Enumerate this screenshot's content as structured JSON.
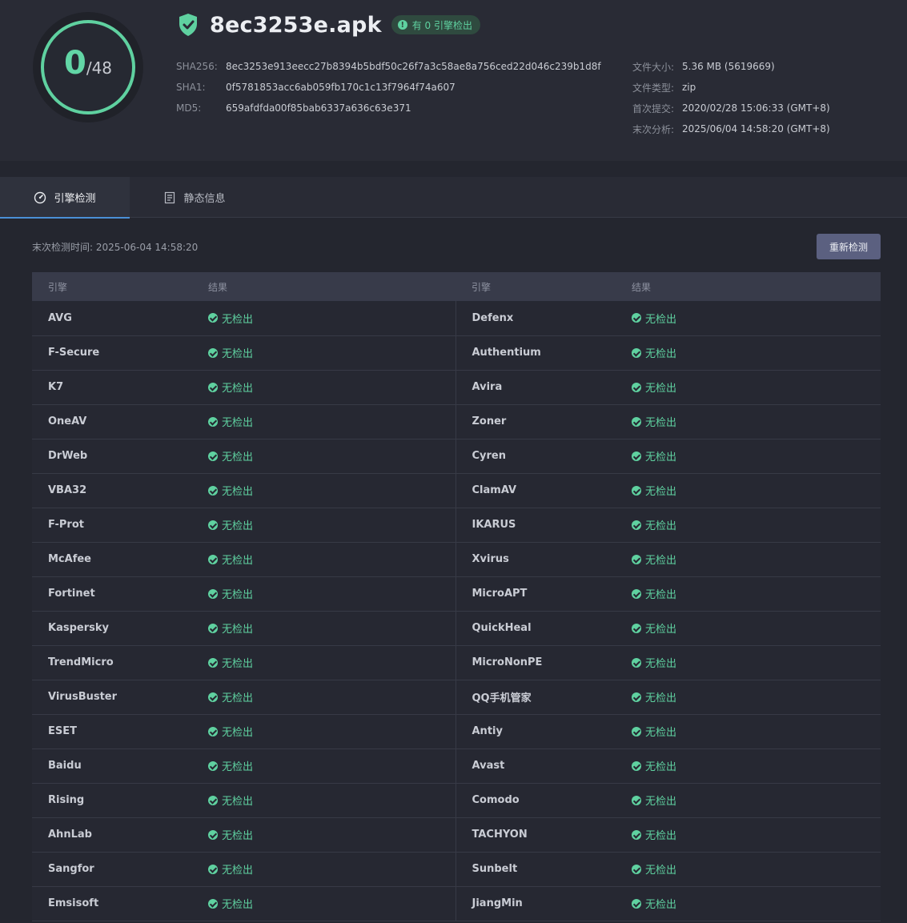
{
  "score": {
    "detected": "0",
    "total": "/48"
  },
  "file": {
    "name": "8ec3253e.apk",
    "badge": "有 0 引擎检出"
  },
  "colors": {
    "accent_green": "#5fd1a0",
    "tab_active": "#4a8fd6",
    "button_bg": "#5b6080"
  },
  "hashes": [
    {
      "label": "SHA256:",
      "value": "8ec3253e913eecc27b8394b5bdf50c26f7a3c58ae8a756ced22d046c239b1d8f"
    },
    {
      "label": "SHA1:",
      "value": "0f5781853acc6ab059fb170c1c13f7964f74a607"
    },
    {
      "label": "MD5:",
      "value": "659afdfda00f85bab6337a636c63e371"
    }
  ],
  "meta": [
    {
      "label": "文件大小:",
      "value": "5.36 MB (5619669)"
    },
    {
      "label": "文件类型:",
      "value": "zip"
    },
    {
      "label": "首次提交:",
      "value": "2020/02/28 15:06:33 (GMT+8)"
    },
    {
      "label": "末次分析:",
      "value": "2025/06/04 14:58:20 (GMT+8)"
    }
  ],
  "tabs": [
    {
      "label": "引擎检测",
      "icon": "gauge-icon",
      "active": true
    },
    {
      "label": "静态信息",
      "icon": "document-icon",
      "active": false
    }
  ],
  "scan": {
    "last_time": "末次检测时间: 2025-06-04 14:58:20",
    "rescan_label": "重新检测"
  },
  "table": {
    "headers": [
      "引擎",
      "结果",
      "引擎",
      "结果"
    ],
    "rows": [
      {
        "left": "AVG",
        "left_result": "无检出",
        "right": "Defenx",
        "right_result": "无检出"
      },
      {
        "left": "F-Secure",
        "left_result": "无检出",
        "right": "Authentium",
        "right_result": "无检出"
      },
      {
        "left": "K7",
        "left_result": "无检出",
        "right": "Avira",
        "right_result": "无检出"
      },
      {
        "left": "OneAV",
        "left_result": "无检出",
        "right": "Zoner",
        "right_result": "无检出"
      },
      {
        "left": "DrWeb",
        "left_result": "无检出",
        "right": "Cyren",
        "right_result": "无检出"
      },
      {
        "left": "VBA32",
        "left_result": "无检出",
        "right": "ClamAV",
        "right_result": "无检出"
      },
      {
        "left": "F-Prot",
        "left_result": "无检出",
        "right": "IKARUS",
        "right_result": "无检出"
      },
      {
        "left": "McAfee",
        "left_result": "无检出",
        "right": "Xvirus",
        "right_result": "无检出"
      },
      {
        "left": "Fortinet",
        "left_result": "无检出",
        "right": "MicroAPT",
        "right_result": "无检出"
      },
      {
        "left": "Kaspersky",
        "left_result": "无检出",
        "right": "QuickHeal",
        "right_result": "无检出"
      },
      {
        "left": "TrendMicro",
        "left_result": "无检出",
        "right": "MicroNonPE",
        "right_result": "无检出"
      },
      {
        "left": "VirusBuster",
        "left_result": "无检出",
        "right": "QQ手机管家",
        "right_result": "无检出"
      },
      {
        "left": "ESET",
        "left_result": "无检出",
        "right": "Antiy",
        "right_result": "无检出"
      },
      {
        "left": "Baidu",
        "left_result": "无检出",
        "right": "Avast",
        "right_result": "无检出"
      },
      {
        "left": "Rising",
        "left_result": "无检出",
        "right": "Comodo",
        "right_result": "无检出"
      },
      {
        "left": "AhnLab",
        "left_result": "无检出",
        "right": "TACHYON",
        "right_result": "无检出"
      },
      {
        "left": "Sangfor",
        "left_result": "无检出",
        "right": "Sunbelt",
        "right_result": "无检出"
      },
      {
        "left": "Emsisoft",
        "left_result": "无检出",
        "right": "JiangMin",
        "right_result": "无检出"
      }
    ]
  }
}
